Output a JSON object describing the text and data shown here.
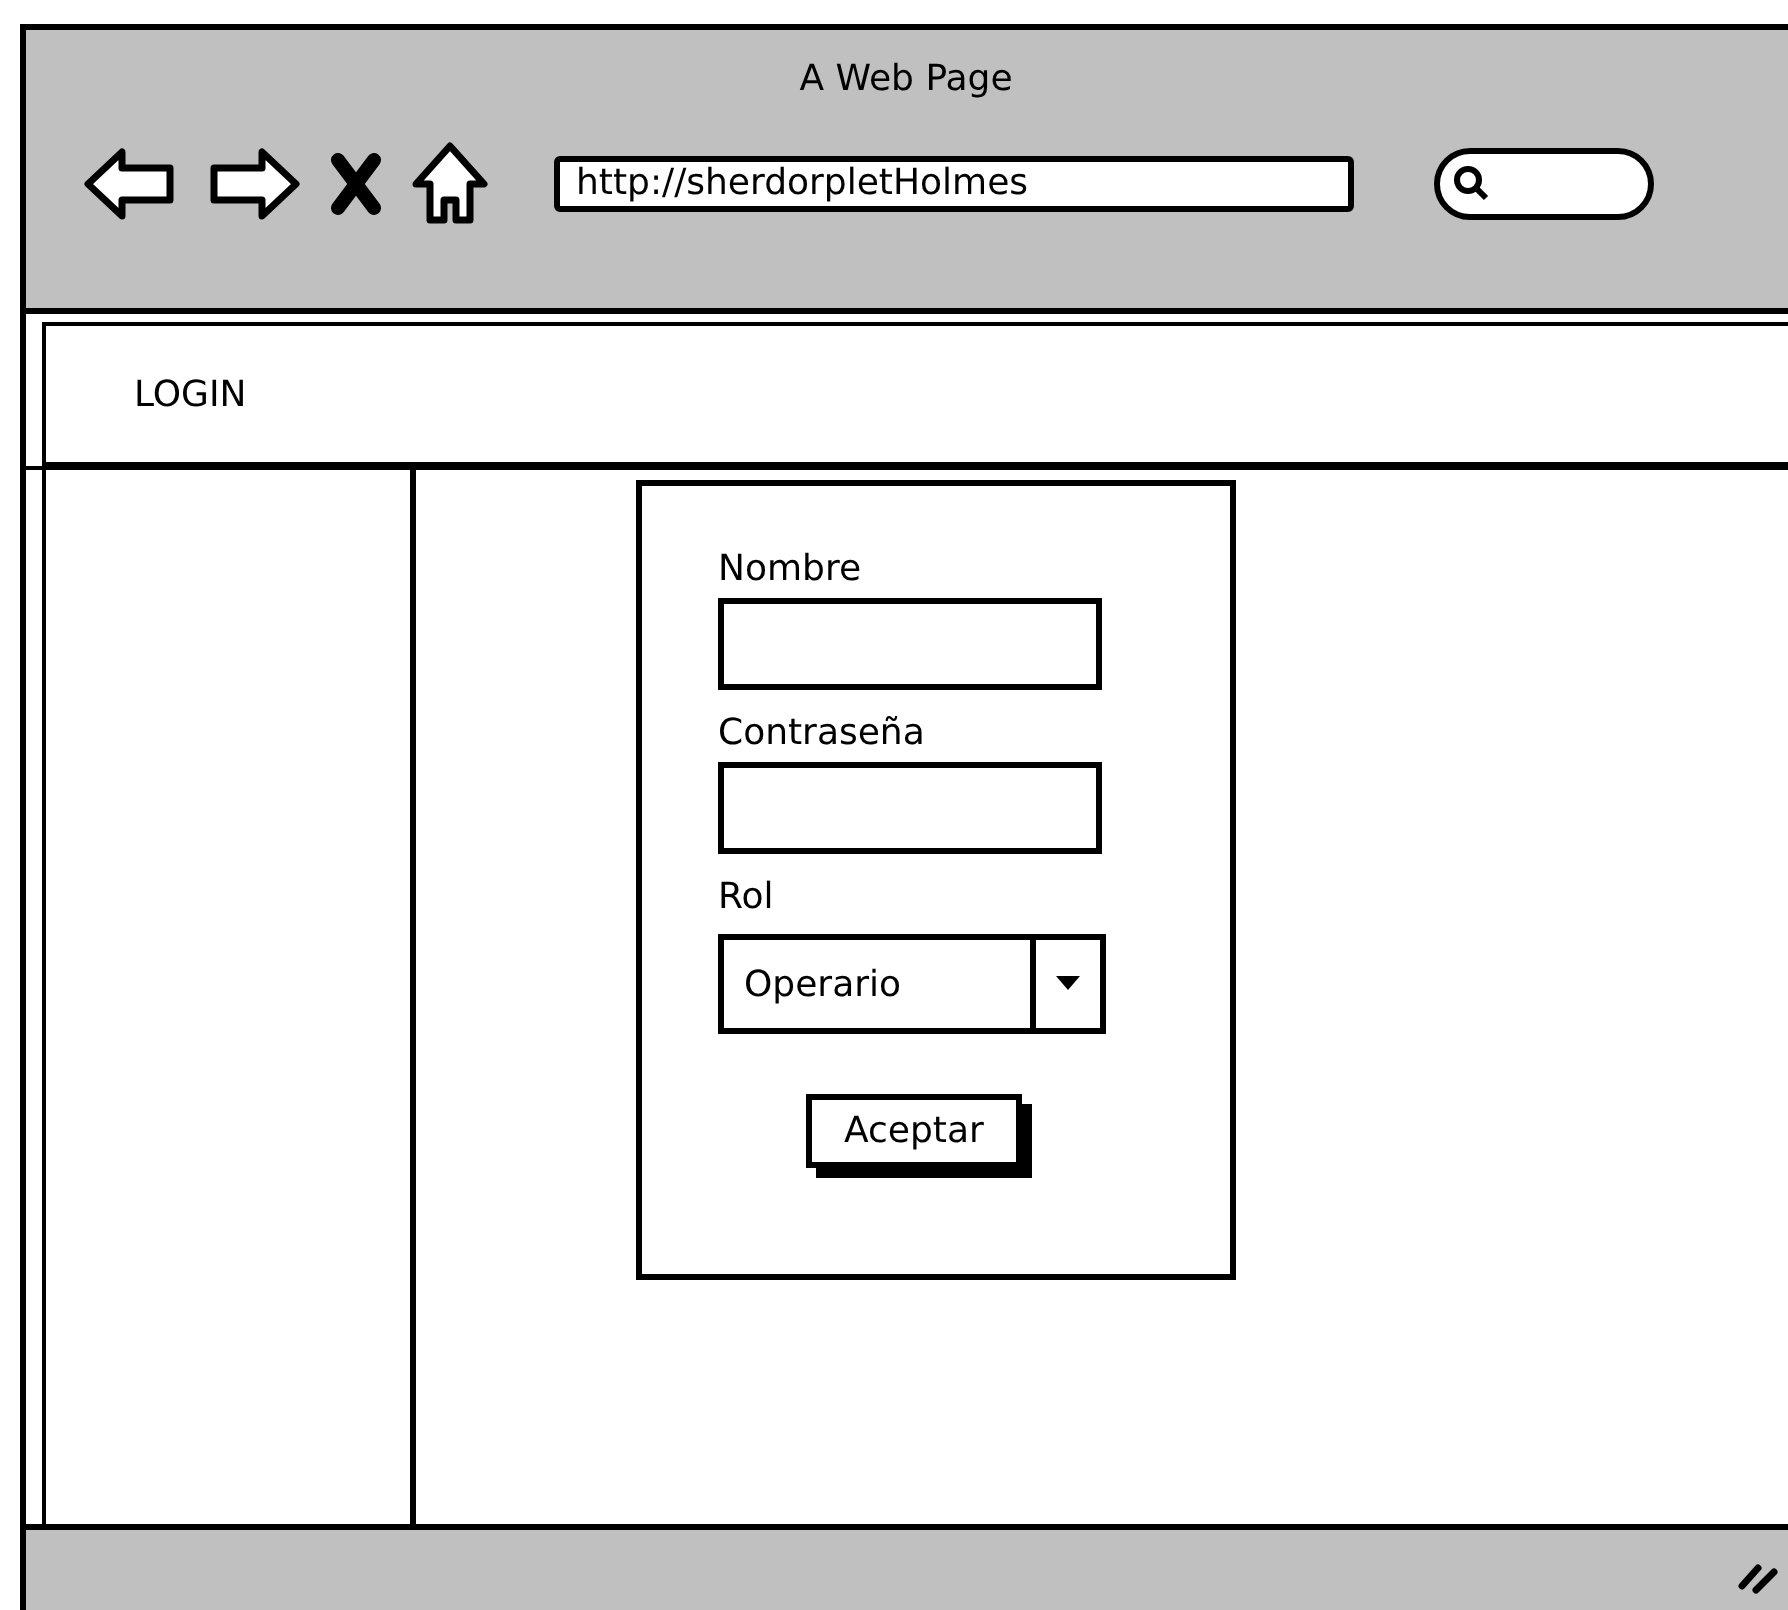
{
  "window": {
    "title": "A Web Page"
  },
  "toolbar": {
    "url": "http://sherdorpletHolmes"
  },
  "nav": {
    "label": "LOGIN"
  },
  "form": {
    "fields": [
      {
        "label": "Nombre",
        "kind": "text"
      },
      {
        "label": "Contraseña",
        "kind": "text"
      },
      {
        "label": "Rol",
        "kind": "select",
        "value": "Operario"
      }
    ],
    "button": "Aceptar"
  }
}
